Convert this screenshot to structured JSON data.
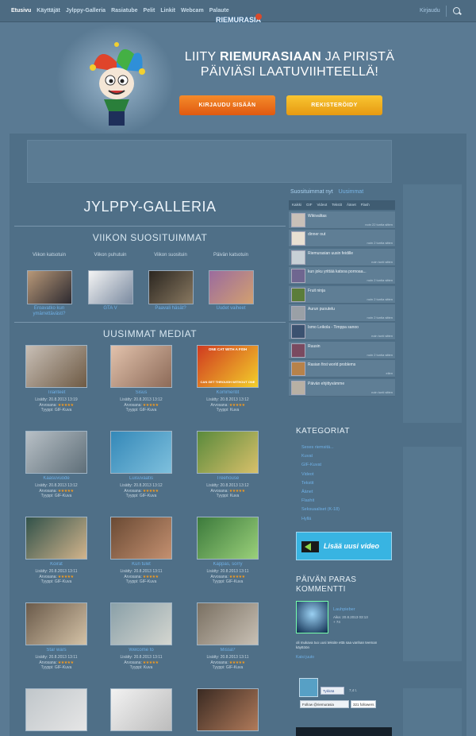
{
  "nav": {
    "items": [
      {
        "label": "Etusivu",
        "active": true
      },
      {
        "label": "Käyttäjät"
      },
      {
        "label": "Jylppy-Galleria"
      },
      {
        "label": "Rasiatube"
      },
      {
        "label": "Pelit"
      },
      {
        "label": "Linkit"
      },
      {
        "label": "Webcam"
      },
      {
        "label": "Palaute"
      }
    ],
    "logo": "RIEMURASIA",
    "logo_badge": "1",
    "login_link": "Kirjaudu"
  },
  "hero": {
    "line1_a": "LIITY ",
    "line1_b": "RIEMURASIAAN",
    "line1_c": " JA PIRISTÄ",
    "line2": "PÄIVIÄSI LAATUVIIHTEELLÄ!",
    "login_button": "KIRJAUDU SISÄÄN",
    "register_button": "REKISTERÖIDY"
  },
  "gallery": {
    "title": "JYLPPY-GALLERIA",
    "weekly_title": "VIIKON SUOSITUIMMAT",
    "weekly": [
      {
        "label": "Viikon katsotuin",
        "title": "Eroavatko kun ymärrettävästi?",
        "colors": [
          "#b89878",
          "#2d2a30"
        ]
      },
      {
        "label": "Viikon puhutuin",
        "title": "GTA V",
        "colors": [
          "#f4f4f4",
          "#7a8aa0"
        ]
      },
      {
        "label": "Viikon suosituin",
        "title": "Paavali häsät?",
        "colors": [
          "#2b2620",
          "#887860"
        ]
      },
      {
        "label": "Päivän katsotuin",
        "title": "Uudet vaiheet",
        "colors": [
          "#9b6b9e",
          "#d2a070"
        ]
      }
    ],
    "newest_title": "UUSIMMAT MEDIAT",
    "added_label": "Lisätty:",
    "rating_label": "Arvosana:",
    "type_label": "Tyyppi:",
    "items": [
      {
        "title": "Tilanteet",
        "date": "20.8.2013 13:19",
        "type": "GIF-Kuva",
        "colors": [
          "#c8bfb6",
          "#6e5a44"
        ]
      },
      {
        "title": "Sisus",
        "date": "20.8.2013 13:12",
        "type": "GIF-Kuva",
        "colors": [
          "#e2c2ac",
          "#8c6a58"
        ]
      },
      {
        "title": "Kommentit",
        "date": "20.8.2013 13:12",
        "type": "Kuva",
        "colors": [
          "#d03a20",
          "#f3cf2a"
        ],
        "caption": "ONE CAT WITH A FISH",
        "caption2": "CAN GET THROUGH WITHOUT ONE"
      },
      {
        "title": "Kaasuvuode",
        "date": "20.8.2013 13:12",
        "type": "GIF-Kuva",
        "colors": [
          "#b8c0c6",
          "#5e6e78"
        ]
      },
      {
        "title": "Luisuvaatis",
        "date": "20.8.2013 13:12",
        "type": "GIF-Kuva",
        "colors": [
          "#3488b8",
          "#7ec0dd"
        ]
      },
      {
        "title": "Treehouse",
        "date": "20.8.2013 13:12",
        "type": "Kuva",
        "colors": [
          "#5a8a3c",
          "#d8c06a"
        ]
      },
      {
        "title": "Koirat",
        "date": "20.8.2013 13:11",
        "type": "GIF-Kuva",
        "colors": [
          "#31524a",
          "#d2b48c"
        ]
      },
      {
        "title": "Kun tulet",
        "date": "20.8.2013 13:11",
        "type": "GIF-Kuva",
        "colors": [
          "#6a4a34",
          "#c49070"
        ]
      },
      {
        "title": "Kappas, sorry",
        "date": "20.8.2013 13:11",
        "type": "GIF-Kuva",
        "colors": [
          "#3c7a3c",
          "#9ad07a"
        ]
      },
      {
        "title": "Star wars",
        "date": "20.8.2013 13:11",
        "type": "GIF-Kuva",
        "colors": [
          "#6a5a4a",
          "#d4c2a6"
        ]
      },
      {
        "title": "Welcome to",
        "date": "20.8.2013 13:11",
        "type": "Kuva",
        "colors": [
          "#8aa0a8",
          "#d4d6d0"
        ]
      },
      {
        "title": "Missä?",
        "date": "20.8.2013 13:11",
        "type": "GIF-Kuva",
        "colors": [
          "#7a7062",
          "#c8c0b4"
        ]
      },
      {
        "title": "",
        "date": "",
        "type": "",
        "colors": [
          "#c0c6ca",
          "#e6e6e6"
        ]
      },
      {
        "title": "",
        "date": "",
        "type": "",
        "colors": [
          "#f2f2f2",
          "#bcbcbc"
        ]
      },
      {
        "title": "",
        "date": "",
        "type": "",
        "colors": [
          "#3a2a22",
          "#b07a5a"
        ]
      }
    ]
  },
  "sidebar": {
    "tabs": [
      {
        "label": "Suosituimmat nyt",
        "active": true
      },
      {
        "label": "Uusimmat"
      }
    ],
    "filters": [
      "Kaikki",
      "GIF",
      "Videot",
      "Tekstit",
      "Äänet",
      "Flash"
    ],
    "list": [
      {
        "title": "Wikivalitas",
        "time": "noin 22 tuntia sitten",
        "color": "#c9c0b8"
      },
      {
        "title": "dinner out",
        "time": "noin 2 tuntia sitten",
        "color": "#e8e0d2"
      },
      {
        "title": "Riemurasian uusin feidille",
        "time": "noin tunti sitten",
        "color": "#c7d0d6"
      },
      {
        "title": "kun joku yrittää katsoa pornoaa...",
        "time": "noin 2 tuntia sitten",
        "color": "#6f6690"
      },
      {
        "title": "Fruit ninja",
        "time": "noin 2 tuntia sitten",
        "color": "#5b7d3a"
      },
      {
        "title": "Aurun puoutelu",
        "time": "noin 2 tuntia sitten",
        "color": "#9aa0a6"
      },
      {
        "title": "Ismo Leikola - Timppa sanoo",
        "time": "noin tunti sitten",
        "color": "#3b5270"
      },
      {
        "title": "Ruusin",
        "time": "noin 2 tuntia sitten",
        "color": "#7a4a60"
      },
      {
        "title": "Rasian first world problems",
        "time": "eilen",
        "color": "#b7824a"
      },
      {
        "title": "Päivän ehjittyvämme",
        "time": "noin tunti sitten",
        "color": "#b8b0a4"
      }
    ],
    "categories_title": "KATEGORIAT",
    "categories": [
      "Sexes riemsitä...",
      "Kuvat",
      "GIF-Kuvat",
      "Videot",
      "Tekstit",
      "Äänet",
      "Flashit",
      "Seksuaaliset (K-18)",
      "Hyllä"
    ],
    "add_video": "Lisää uusi video",
    "comment_title_1": "PÄIVÄN PARAS",
    "comment_title_2": "KOMMENTTI",
    "comment_user": "Lauhpieber",
    "comment_date": "Aika: 20.8.2013 03:13",
    "comment_score": "+ 74",
    "comment_text": "oli mukava tuo uusi teksite että saa vanhan teeman käyttöön",
    "comment_link": "Kaisi juuto",
    "fb_like": "Tykkää",
    "fb_count": "7,4 t.",
    "twitter_follow": "Follow @riemurasia",
    "twitter_count": "321 followers"
  }
}
